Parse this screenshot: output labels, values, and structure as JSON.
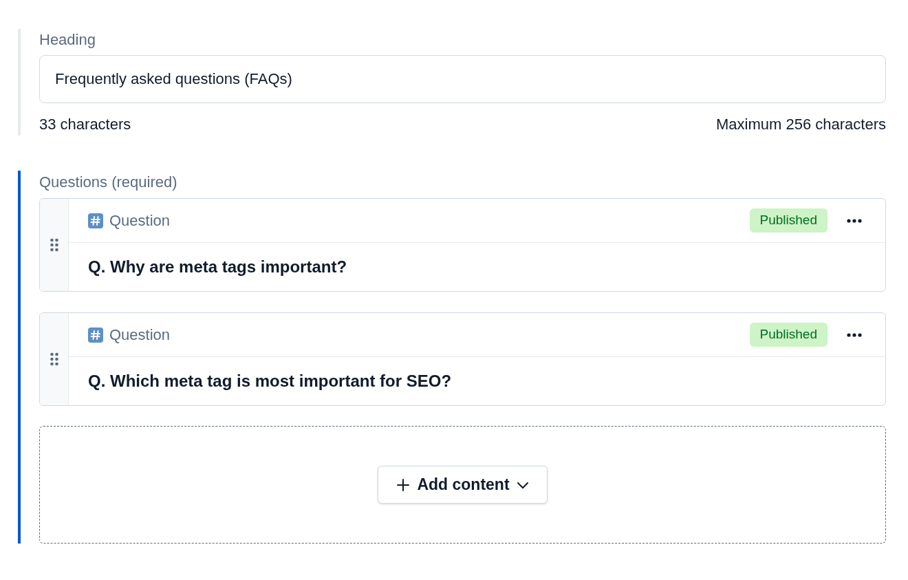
{
  "heading_field": {
    "label": "Heading",
    "active": false,
    "value": "Frequently asked questions (FAQs)",
    "count": "33 characters",
    "limit": "Maximum 256 characters"
  },
  "questions": {
    "label": "Questions (required)",
    "active": true,
    "items": [
      {
        "type": "Question",
        "status": "Published",
        "title": "Q. Why are meta tags important?"
      },
      {
        "type": "Question",
        "status": "Published",
        "title": "Q. Which meta tag is most important for SEO?"
      }
    ],
    "add_button": "Add content"
  }
}
